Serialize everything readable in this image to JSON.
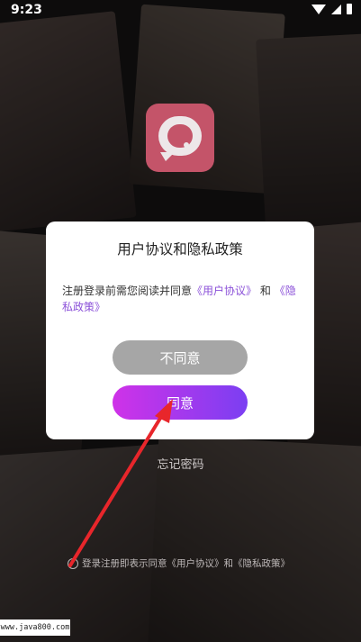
{
  "status_bar": {
    "time": "9:23"
  },
  "dialog": {
    "title": "用户协议和隐私政策",
    "message_prefix": "注册登录前需您阅读并同意",
    "link_user_agreement": "《用户协议》",
    "message_and": "和",
    "link_privacy_policy": "《隐私政策》",
    "disagree_label": "不同意",
    "agree_label": "同意"
  },
  "login": {
    "forgot_password": "忘记密码",
    "agreement_text": "登录注册即表示同意《用户协议》和《隐私政策》"
  },
  "watermark": "www.java800.com",
  "colors": {
    "logo_bg": "#c45469",
    "agree_gradient_start": "#cf32e8",
    "agree_gradient_end": "#7b3ff2",
    "disagree_bg": "#a6a6a6",
    "link": "#8c52d9",
    "arrow": "#e8262b"
  }
}
